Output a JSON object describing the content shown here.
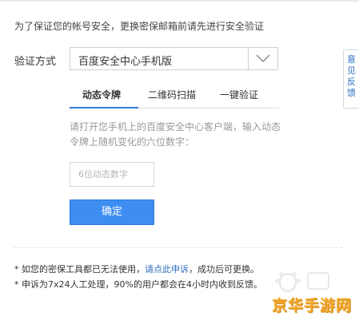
{
  "intro_text": "为了保证您的帐号安全，更换密保邮箱前请先进行安全验证",
  "verify": {
    "label": "验证方式",
    "selected": "百度安全中心手机版"
  },
  "tabs": [
    {
      "label": "动态令牌",
      "active": true
    },
    {
      "label": "二维码扫描",
      "active": false
    },
    {
      "label": "一键验证",
      "active": false
    }
  ],
  "hint_text": "请打开您手机上的百度安全中心客户端，输入动态令牌上随机变化的六位数字：",
  "code_input": {
    "value": "",
    "placeholder": "6位动态数字"
  },
  "confirm_button": "确定",
  "notes": {
    "note1_before": "* 如您的密保工具都已无法使用，",
    "note1_link": "请点此申诉",
    "note1_after": "，成功后可更换。",
    "note2": "* 申诉为7x24人工处理，90%的用户都会在4小时内收到反馈。"
  },
  "feedback_tab": [
    "意",
    "见",
    "反",
    "馈"
  ],
  "watermark": {
    "brand": "京华手游网"
  },
  "colors": {
    "accent": "#3d8ef0",
    "link": "#2f6fbf",
    "watermark": "#f2a72a"
  },
  "icons": {
    "select_arrow": "chevron-down-icon"
  }
}
